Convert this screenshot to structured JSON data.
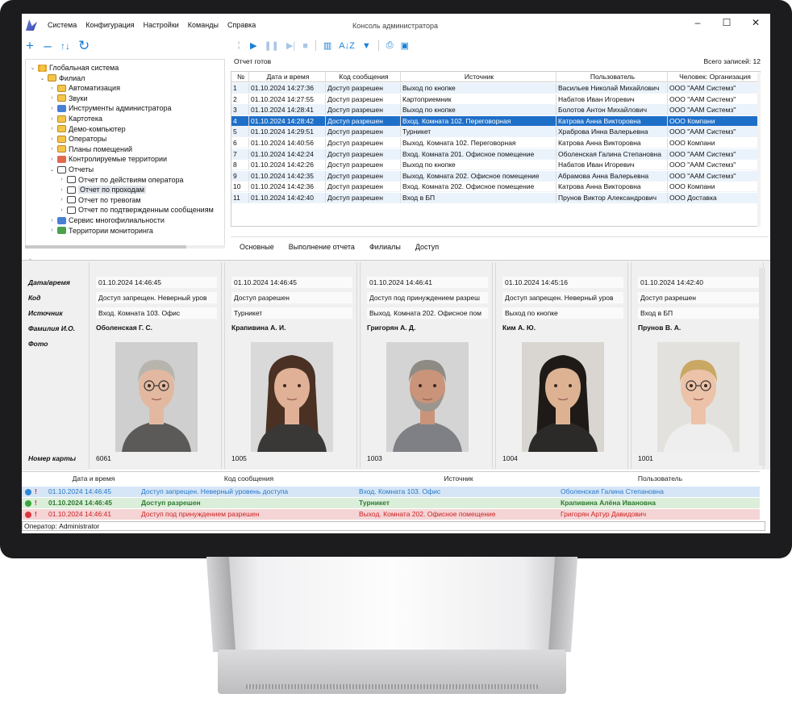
{
  "window": {
    "title": "Консоль администратора",
    "menu": [
      "Система",
      "Конфигурация",
      "Настройки",
      "Команды",
      "Справка"
    ],
    "controls": [
      "–",
      "☐",
      "✕"
    ]
  },
  "left_toolbar": {
    "add": "+",
    "remove": "–",
    "sort": "↑↓",
    "refresh": "↻"
  },
  "tree": [
    {
      "label": "Глобальная система",
      "icon": "globe-icon",
      "depth": 0,
      "expanded": true
    },
    {
      "label": "Филиал",
      "icon": "folder-icon",
      "depth": 1,
      "expanded": true
    },
    {
      "label": "Автоматизация",
      "icon": "folder-icon",
      "depth": 2
    },
    {
      "label": "Звуки",
      "icon": "sound-icon",
      "depth": 2
    },
    {
      "label": "Инструменты администратора",
      "icon": "tools-icon",
      "depth": 2
    },
    {
      "label": "Картотека",
      "icon": "cardfile-icon",
      "depth": 2
    },
    {
      "label": "Демо-компьютер",
      "icon": "computer-icon",
      "depth": 2
    },
    {
      "label": "Операторы",
      "icon": "folder-icon",
      "depth": 2
    },
    {
      "label": "Планы помещений",
      "icon": "folder-icon",
      "depth": 2
    },
    {
      "label": "Контролируемые территории",
      "icon": "territory-icon",
      "depth": 2
    },
    {
      "label": "Отчеты",
      "icon": "report-icon",
      "depth": 2,
      "expanded": true
    },
    {
      "label": "Отчет по действиям оператора",
      "icon": "report-icon",
      "depth": 3
    },
    {
      "label": "Отчет по проходам",
      "icon": "report-icon",
      "depth": 3,
      "selected": true
    },
    {
      "label": "Отчет по тревогам",
      "icon": "report-icon",
      "depth": 3
    },
    {
      "label": "Отчет по подтвержденным сообщениям",
      "icon": "report-icon",
      "depth": 3
    },
    {
      "label": "Сервис многофилиальности",
      "icon": "service-icon",
      "depth": 2
    },
    {
      "label": "Территории мониторинга",
      "icon": "monitoring-icon",
      "depth": 2
    }
  ],
  "report": {
    "status": "Отчет готов",
    "total": "Всего записей: 12",
    "columns": [
      "№",
      "Дата и время",
      "Код сообщения",
      "Источник",
      "Пользователь",
      "Человек: Организация"
    ],
    "rows": [
      [
        "1",
        "01.10.2024 14:27:36",
        "Доступ разрешен",
        "Выход по кнопке",
        "Васильев Николай Михайлович",
        "ООО \"ААМ Системз\""
      ],
      [
        "2",
        "01.10.2024 14:27:55",
        "Доступ разрешен",
        "Картоприемник",
        "Набатов Иван Игоревич",
        "ООО \"ААМ Системз\""
      ],
      [
        "3",
        "01.10.2024 14:28:41",
        "Доступ разрешен",
        "Выход по кнопке",
        "Болотов Антон Михайлович",
        "ООО \"ААМ Системз\""
      ],
      [
        "4",
        "01.10.2024 14:28:42",
        "Доступ разрешен",
        "Вход. Комната 102. Переговорная",
        "Катрова Анна Викторовна",
        "ООО Компани"
      ],
      [
        "5",
        "01.10.2024 14:29:51",
        "Доступ разрешен",
        "Турникет",
        "Храброва Инна Валерьевна",
        "ООО \"ААМ Системз\""
      ],
      [
        "6",
        "01.10.2024 14:40:56",
        "Доступ разрешен",
        "Выход. Комната 102. Переговорная",
        "Катрова Анна Викторовна",
        "ООО Компани"
      ],
      [
        "7",
        "01.10.2024 14:42:24",
        "Доступ разрешен",
        "Вход. Комната 201. Офисное помещение",
        "Оболенская Галина Степановна",
        "ООО \"ААМ Системз\""
      ],
      [
        "8",
        "01.10.2024 14:42:26",
        "Доступ разрешен",
        "Выход по кнопке",
        "Набатов Иван Игоревич",
        "ООО \"ААМ Системз\""
      ],
      [
        "9",
        "01.10.2024 14:42:35",
        "Доступ разрешен",
        "Выход. Комната 202. Офисное помещение",
        "Абрамова Анна Валерьевна",
        "ООО \"ААМ Системз\""
      ],
      [
        "10",
        "01.10.2024 14:42:36",
        "Доступ разрешен",
        "Вход. Комната 202. Офисное помещение",
        "Катрова Анна Викторовна",
        "ООО Компани"
      ],
      [
        "11",
        "01.10.2024 14:42:40",
        "Доступ разрешен",
        "Вход в БП",
        "Прунов Виктор Александрович",
        "ООО Доставка"
      ]
    ],
    "selected_row": 4
  },
  "tabs": [
    "Основные",
    "Выполнение отчета",
    "Филиалы",
    "Доступ"
  ],
  "field_labels": {
    "datetime": "Дата/время",
    "code": "Код",
    "source": "Источник",
    "name": "Фамилия И.О.",
    "photo": "Фото",
    "card": "Номер карты"
  },
  "cards": [
    {
      "datetime": "01.10.2024 14:46:45",
      "code": "Доступ запрещен. Неверный уров",
      "source": "Вход. Комната 103. Офис",
      "name": "Оболенская Г. С.",
      "card": "6061",
      "photo": "older-woman-gray-hair-glasses"
    },
    {
      "datetime": "01.10.2024 14:46:45",
      "code": "Доступ разрешен",
      "source": "Турникет",
      "name": "Крапивина А. И.",
      "card": "1005",
      "photo": "young-woman-long-brown-hair"
    },
    {
      "datetime": "01.10.2024 14:46:41",
      "code": "Доступ под принуждением разреш",
      "source": "Выход. Комната 202. Офисное пом",
      "name": "Григорян А. Д.",
      "card": "1003",
      "photo": "man-gray-hair-beard"
    },
    {
      "datetime": "01.10.2024 14:45:16",
      "code": "Доступ запрещен. Неверный уров",
      "source": "Выход по кнопке",
      "name": "Ким А. Ю.",
      "card": "1004",
      "photo": "woman-dark-hair"
    },
    {
      "datetime": "01.10.2024 14:42:40",
      "code": "Доступ разрешен",
      "source": "Вход в БП",
      "name": "Прунов В. А.",
      "card": "1001",
      "photo": "young-man-blond-glasses"
    }
  ],
  "events": {
    "columns": [
      "Дата и время",
      "Код сообщения",
      "Источник",
      "Пользователь"
    ],
    "rows": [
      {
        "dot": "#2e86d4",
        "datetime": "01.10.2024 14:46:45",
        "code": "Доступ запрещен. Неверный уровень доступа",
        "source": "Вход. Комната 103. Офис",
        "user": "Оболенская Галина Степановна"
      },
      {
        "dot": "#3aa53a",
        "datetime": "01.10.2024 14:46:45",
        "code": "Доступ разрешен",
        "source": "Турникет",
        "user": "Крапивина Алёна Ивановна"
      },
      {
        "dot": "#d9363e",
        "datetime": "01.10.2024 14:46:41",
        "code": "Доступ под принуждением разрешен",
        "source": "Выход. Комната 202. Офисное помещение",
        "user": "Григорян Артур Давидович"
      }
    ],
    "alert_mark": "!"
  },
  "operator_status": "Оператор: Administrator"
}
